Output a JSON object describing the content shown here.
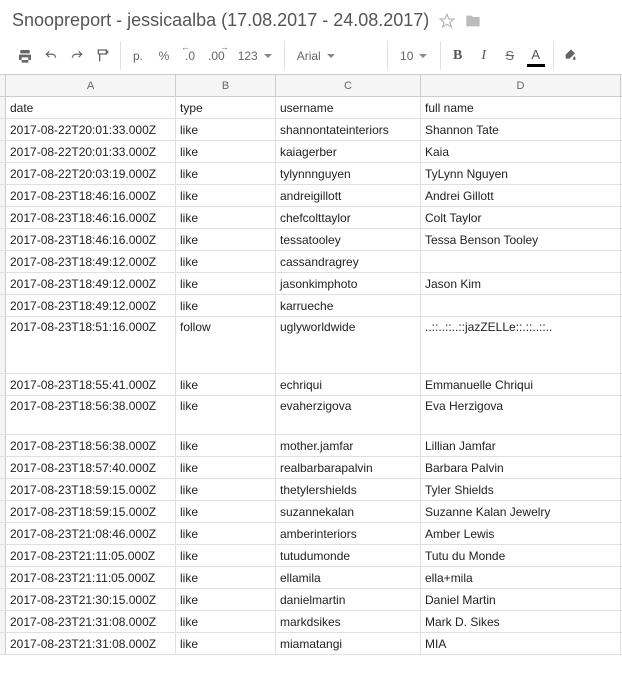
{
  "title": "Snoopreport - jessicaalba (17.08.2017 - 24.08.2017)",
  "toolbar": {
    "currency_label": "р.",
    "percent_label": "%",
    "dec_dec": ".0",
    "dec_inc": ".00",
    "more_formats": "123",
    "font": "Arial",
    "font_size": "10",
    "bold": "B",
    "italic": "I",
    "strike": "S",
    "textcolor": "A"
  },
  "columns": [
    "A",
    "B",
    "C",
    "D"
  ],
  "chart_data": {
    "type": "table",
    "headers": [
      "date",
      "type",
      "username",
      "full name"
    ],
    "rows": [
      {
        "date": "2017-08-22T20:01:33.000Z",
        "type": "like",
        "username": "shannontateinteriors",
        "fullname": "Shannon Tate",
        "tall": ""
      },
      {
        "date": "2017-08-22T20:01:33.000Z",
        "type": "like",
        "username": "kaiagerber",
        "fullname": "Kaia",
        "tall": ""
      },
      {
        "date": "2017-08-22T20:03:19.000Z",
        "type": "like",
        "username": "tylynnnguyen",
        "fullname": "TyLynn Nguyen",
        "tall": ""
      },
      {
        "date": "2017-08-23T18:46:16.000Z",
        "type": "like",
        "username": "andreigillott",
        "fullname": "Andrei Gillott",
        "tall": ""
      },
      {
        "date": "2017-08-23T18:46:16.000Z",
        "type": "like",
        "username": "chefcolttaylor",
        "fullname": "Colt Taylor",
        "tall": ""
      },
      {
        "date": "2017-08-23T18:46:16.000Z",
        "type": "like",
        "username": "tessatooley",
        "fullname": "Tessa Benson Tooley",
        "tall": ""
      },
      {
        "date": "2017-08-23T18:49:12.000Z",
        "type": "like",
        "username": "cassandragrey",
        "fullname": "",
        "tall": ""
      },
      {
        "date": "2017-08-23T18:49:12.000Z",
        "type": "like",
        "username": "jasonkimphoto",
        "fullname": "Jason Kim",
        "tall": ""
      },
      {
        "date": "2017-08-23T18:49:12.000Z",
        "type": "like",
        "username": "karrueche",
        "fullname": "",
        "tall": ""
      },
      {
        "date": "2017-08-23T18:51:16.000Z",
        "type": "follow",
        "username": "uglyworldwide",
        "fullname": "..::..::..::jazZELLe::.::..::..",
        "tall": "tall"
      },
      {
        "date": "2017-08-23T18:55:41.000Z",
        "type": "like",
        "username": "echriqui",
        "fullname": "Emmanuelle Chriqui",
        "tall": ""
      },
      {
        "date": "2017-08-23T18:56:38.000Z",
        "type": "like",
        "username": "evaherzigova",
        "fullname": "Eva Herzigova",
        "tall": "tall2"
      },
      {
        "date": "2017-08-23T18:56:38.000Z",
        "type": "like",
        "username": "mother.jamfar",
        "fullname": "Lillian Jamfar",
        "tall": ""
      },
      {
        "date": "2017-08-23T18:57:40.000Z",
        "type": "like",
        "username": "realbarbarapalvin",
        "fullname": "Barbara Palvin",
        "tall": ""
      },
      {
        "date": "2017-08-23T18:59:15.000Z",
        "type": "like",
        "username": "thetylershields",
        "fullname": "Tyler Shields",
        "tall": ""
      },
      {
        "date": "2017-08-23T18:59:15.000Z",
        "type": "like",
        "username": "suzannekalan",
        "fullname": "Suzanne Kalan Jewelry",
        "tall": ""
      },
      {
        "date": "2017-08-23T21:08:46.000Z",
        "type": "like",
        "username": "amberinteriors",
        "fullname": "Amber  Lewis",
        "tall": ""
      },
      {
        "date": "2017-08-23T21:11:05.000Z",
        "type": "like",
        "username": "tutudumonde",
        "fullname": "Tutu du Monde",
        "tall": ""
      },
      {
        "date": "2017-08-23T21:11:05.000Z",
        "type": "like",
        "username": "ellamila",
        "fullname": "ella+mila",
        "tall": ""
      },
      {
        "date": "2017-08-23T21:30:15.000Z",
        "type": "like",
        "username": "danielmartin",
        "fullname": "Daniel Martin",
        "tall": ""
      },
      {
        "date": "2017-08-23T21:31:08.000Z",
        "type": "like",
        "username": "markdsikes",
        "fullname": "Mark D. Sikes",
        "tall": ""
      },
      {
        "date": "2017-08-23T21:31:08.000Z",
        "type": "like",
        "username": "miamatangi",
        "fullname": "MIA",
        "tall": ""
      }
    ]
  }
}
